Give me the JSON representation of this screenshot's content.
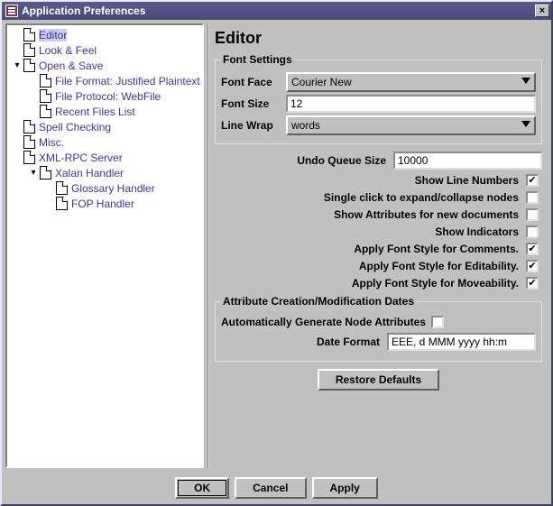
{
  "window": {
    "title": "Application Preferences"
  },
  "tree": {
    "items": [
      {
        "label": "Editor",
        "depth": 0,
        "selected": true
      },
      {
        "label": "Look & Feel",
        "depth": 0
      },
      {
        "label": "Open & Save",
        "depth": 0,
        "expanded": true
      },
      {
        "label": "File Format: Justified Plaintext",
        "depth": 1
      },
      {
        "label": "File Protocol: WebFile",
        "depth": 1
      },
      {
        "label": "Recent Files List",
        "depth": 1
      },
      {
        "label": "Spell Checking",
        "depth": 0
      },
      {
        "label": "Misc.",
        "depth": 0
      },
      {
        "label": "XML-RPC Server",
        "depth": 0
      },
      {
        "label": "Xalan Handler",
        "depth": 1,
        "expanded": true,
        "hasExpander": true
      },
      {
        "label": "Glossary Handler",
        "depth": 2
      },
      {
        "label": "FOP Handler",
        "depth": 2
      }
    ]
  },
  "panel": {
    "title": "Editor",
    "fontSettings": {
      "legend": "Font Settings",
      "face": {
        "label": "Font Face",
        "value": "Courier New"
      },
      "size": {
        "label": "Font Size",
        "value": "12"
      },
      "wrap": {
        "label": "Line Wrap",
        "value": "words"
      }
    },
    "options": {
      "undo": {
        "label": "Undo Queue Size",
        "value": "10000"
      },
      "lineNumbers": {
        "label": "Show Line Numbers",
        "checked": true
      },
      "singleClick": {
        "label": "Single click to expand/collapse nodes",
        "checked": false
      },
      "showAttrs": {
        "label": "Show Attributes for new documents",
        "checked": false
      },
      "indicators": {
        "label": "Show Indicators",
        "checked": false
      },
      "comments": {
        "label": "Apply Font Style for Comments.",
        "checked": true
      },
      "editability": {
        "label": "Apply Font Style for Editability.",
        "checked": true
      },
      "moveability": {
        "label": "Apply Font Style for Moveability.",
        "checked": true
      }
    },
    "attrDates": {
      "legend": "Attribute Creation/Modification Dates",
      "autoGen": {
        "label": "Automatically Generate Node Attributes",
        "checked": false
      },
      "dateFormat": {
        "label": "Date Format",
        "value": "EEE, d MMM yyyy hh:m"
      }
    },
    "restore": "Restore Defaults"
  },
  "buttons": {
    "ok": "OK",
    "cancel": "Cancel",
    "apply": "Apply"
  }
}
